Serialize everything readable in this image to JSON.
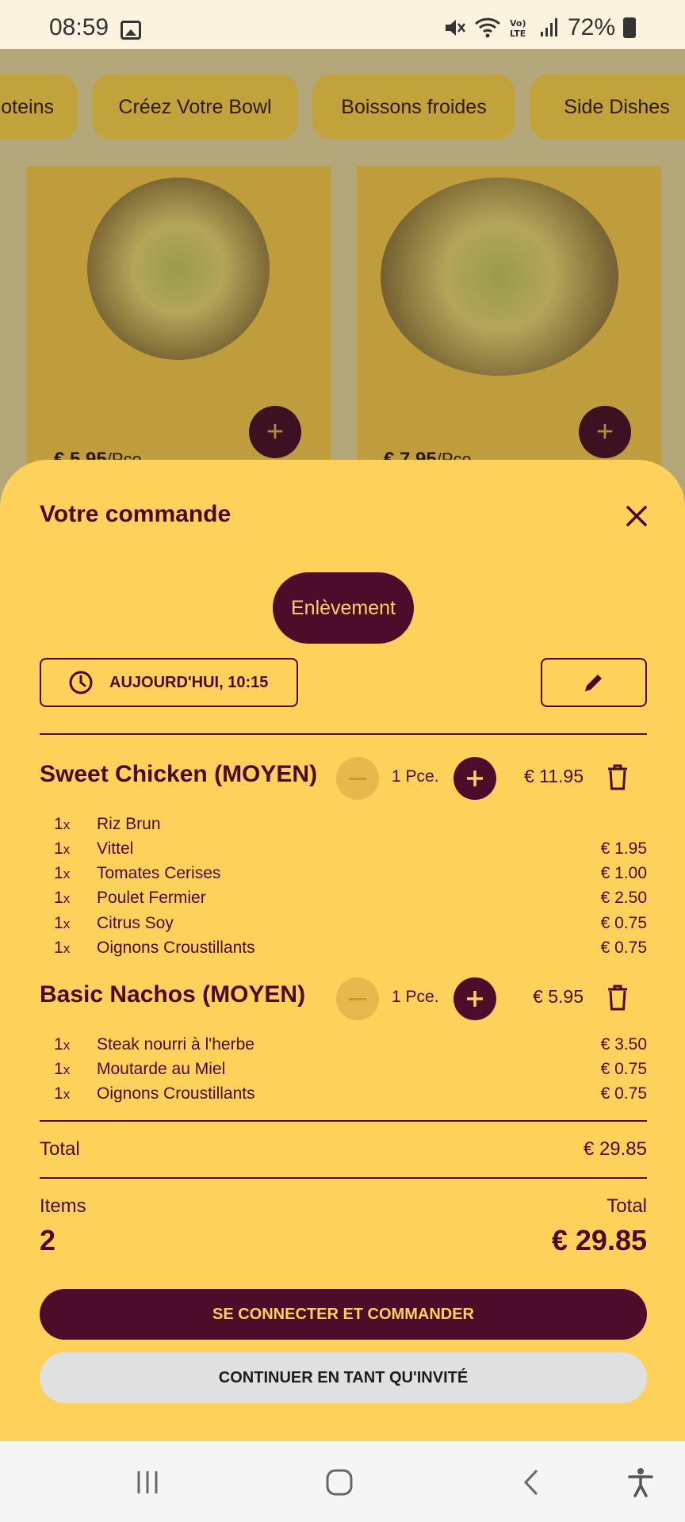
{
  "status_bar": {
    "time": "08:59",
    "battery": "72%",
    "icons": [
      "image-icon",
      "mute-icon",
      "wifi-icon",
      "volte-icon",
      "signal-icon",
      "battery-icon"
    ]
  },
  "categories": [
    "oteins",
    "Créez Votre Bowl",
    "Boissons froides",
    "Side Dishes"
  ],
  "products": [
    {
      "price": "€ 5.95",
      "unit": "/Pce."
    },
    {
      "price": "€ 7.95",
      "unit": "/Pce."
    }
  ],
  "order": {
    "title": "Votre commande",
    "mode": "Enlèvement",
    "pickup_time": "AUJOURD'HUI, 10:15",
    "items": [
      {
        "name": "Sweet Chicken (MOYEN)",
        "qty": "1 Pce.",
        "price": "€ 11.95",
        "extras": [
          {
            "qty": "1",
            "name": "Riz Brun",
            "price": ""
          },
          {
            "qty": "1",
            "name": "Vittel",
            "price": "€ 1.95"
          },
          {
            "qty": "1",
            "name": "Tomates Cerises",
            "price": "€ 1.00"
          },
          {
            "qty": "1",
            "name": "Poulet Fermier",
            "price": "€ 2.50"
          },
          {
            "qty": "1",
            "name": "Citrus Soy",
            "price": "€ 0.75"
          },
          {
            "qty": "1",
            "name": "Oignons Croustillants",
            "price": "€ 0.75"
          }
        ]
      },
      {
        "name": "Basic Nachos (MOYEN)",
        "qty": "1 Pce.",
        "price": "€ 5.95",
        "extras": [
          {
            "qty": "1",
            "name": "Steak nourri à l'herbe",
            "price": "€ 3.50"
          },
          {
            "qty": "1",
            "name": "Moutarde au Miel",
            "price": "€ 0.75"
          },
          {
            "qty": "1",
            "name": "Oignons Croustillants",
            "price": "€ 0.75"
          }
        ]
      }
    ],
    "x_suffix": "x",
    "total_label": "Total",
    "total_value": "€ 29.85",
    "items_label": "Items",
    "items_count": "2",
    "summary_total_label": "Total",
    "summary_total_value": "€ 29.85",
    "login_button": "SE CONNECTER ET COMMANDER",
    "guest_button": "CONTINUER EN TANT QU'INVITÉ"
  },
  "colors": {
    "sheet": "#fed15a",
    "primary": "#4e0c2b",
    "text": "#4a0a27",
    "secondary_button": "#e0e0e0"
  }
}
